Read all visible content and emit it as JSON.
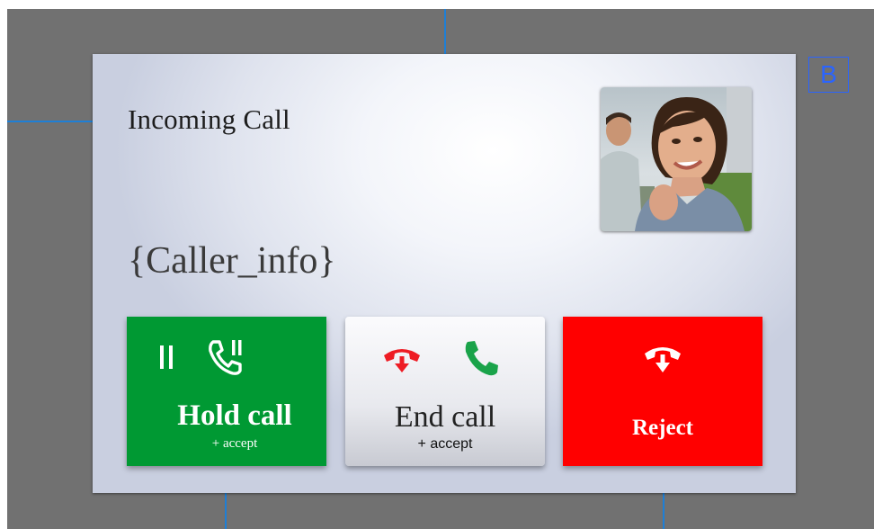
{
  "screen": {
    "title": "Incoming Call",
    "caller_info": "{Caller_info}",
    "badge": "B"
  },
  "buttons": {
    "hold": {
      "label": "Hold call",
      "sub": "+ accept",
      "color": "#009933"
    },
    "end": {
      "label": "End call",
      "sub": "+ accept"
    },
    "reject": {
      "label": "Reject",
      "color": "#ff0000"
    }
  },
  "icons": {
    "hold": [
      "pause-icon",
      "phone-hold-icon"
    ],
    "end": [
      "hang-up-icon",
      "phone-accept-icon"
    ],
    "reject": [
      "hang-up-icon"
    ]
  },
  "colors": {
    "background": "#717171",
    "annotation": "#1e7fd6",
    "hang_up_red": "#ee1c24",
    "accept_green": "#1aa34a"
  }
}
